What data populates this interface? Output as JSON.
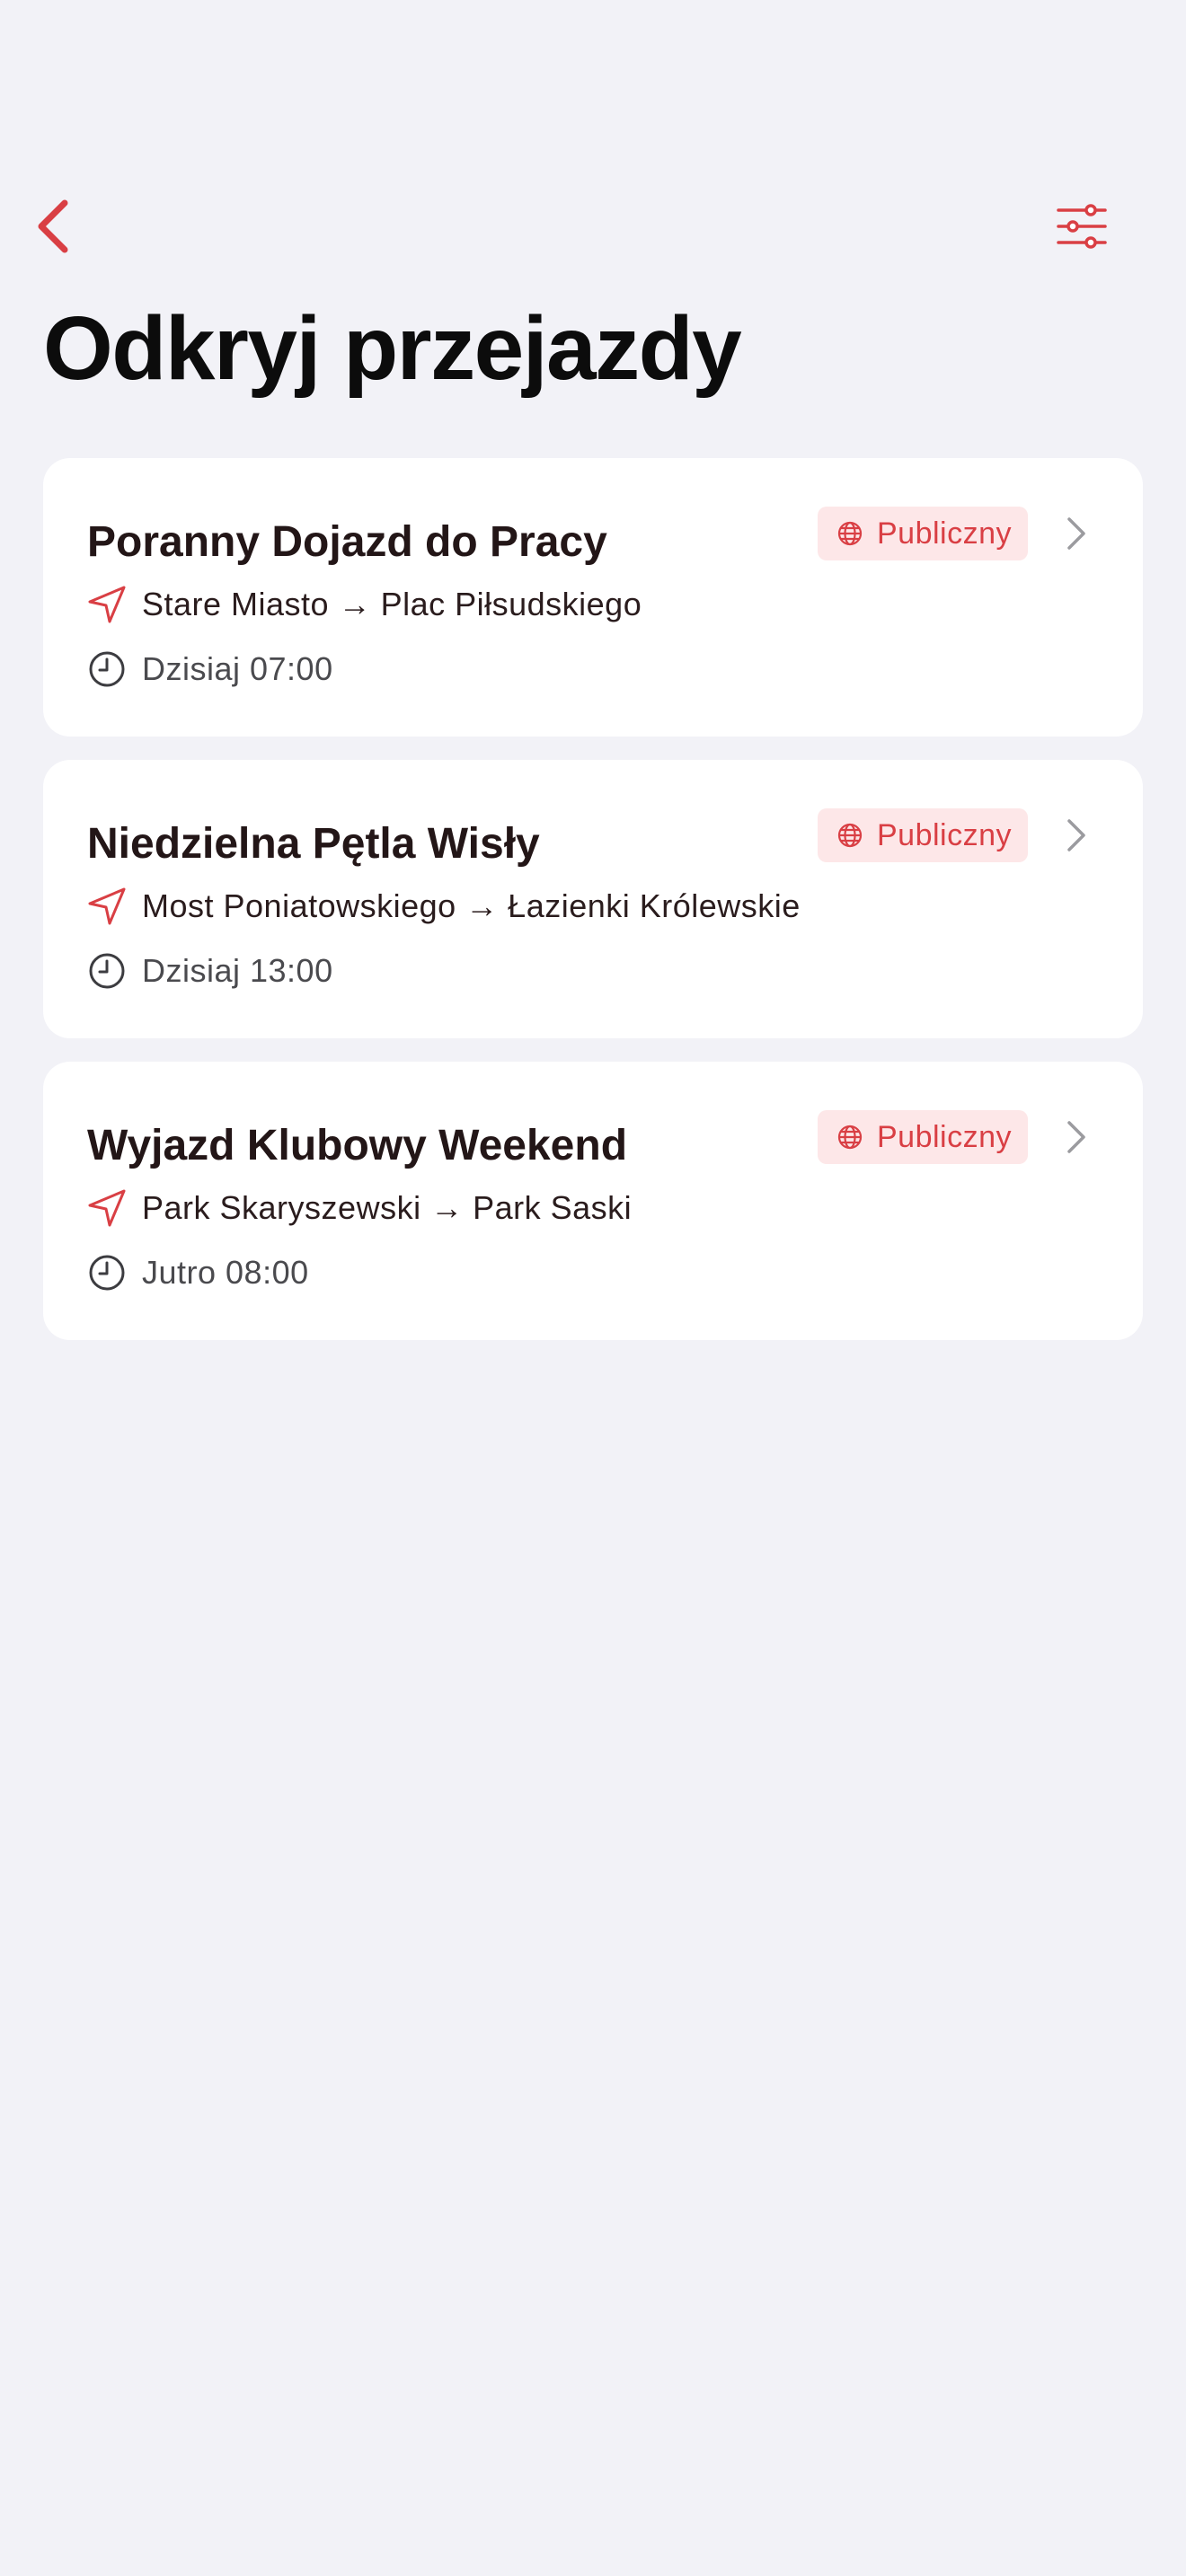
{
  "header": {
    "title": "Odkryj przejazdy",
    "back_icon": "chevron-left-icon",
    "filter_icon": "sliders-icon"
  },
  "colors": {
    "accent": "#d93f44",
    "badge_bg": "#fde7e8",
    "background": "#f2f2f7",
    "card": "#ffffff"
  },
  "rides": [
    {
      "title": "Poranny Dojazd do Pracy",
      "badge": "Publiczny",
      "route": "Stare Miasto → Plac Piłsudskiego",
      "time": "Dzisiaj 07:00"
    },
    {
      "title": "Niedzielna Pętla Wisły",
      "badge": "Publiczny",
      "route": "Most Poniatowskiego → Łazienki Królewskie",
      "time": "Dzisiaj 13:00"
    },
    {
      "title": "Wyjazd Klubowy Weekend",
      "badge": "Publiczny",
      "route": "Park Skaryszewski → Park Saski",
      "time": "Jutro 08:00"
    }
  ]
}
